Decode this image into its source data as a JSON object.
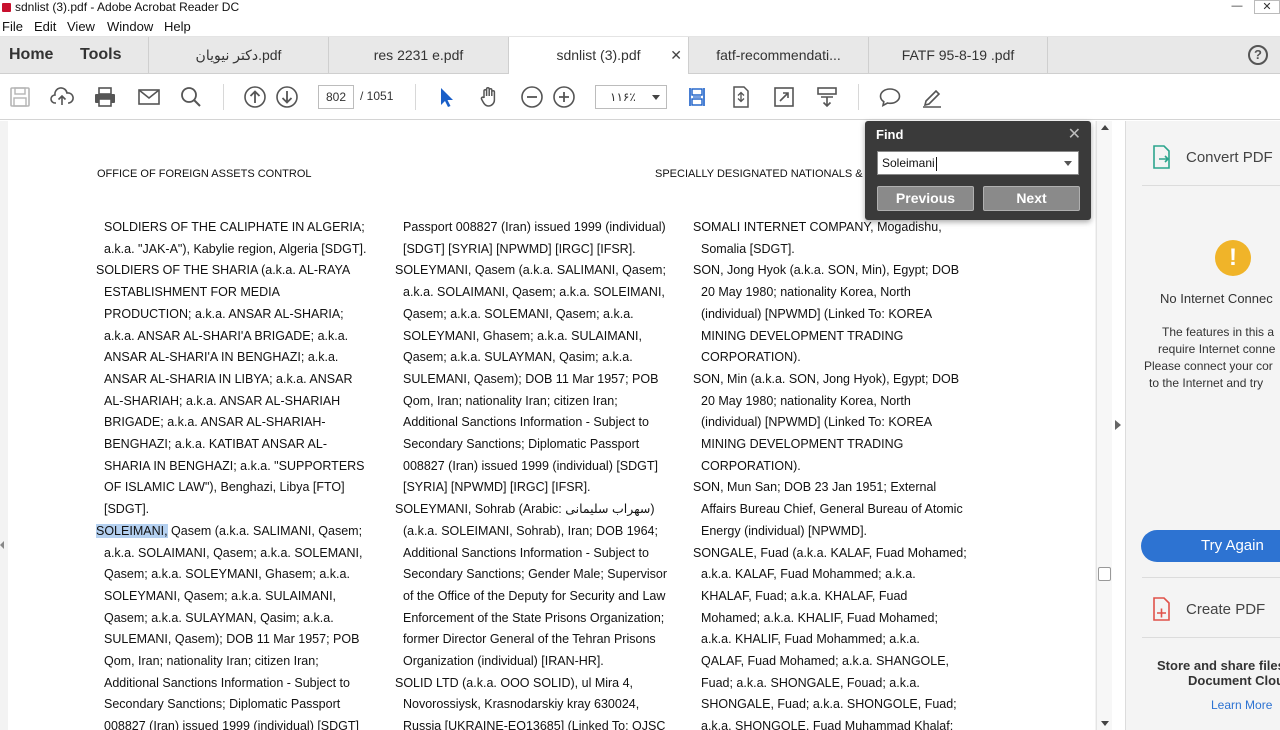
{
  "window": {
    "title": "sdnlist (3).pdf - Adobe Acrobat Reader DC",
    "min_label": "—",
    "close_label": "✕"
  },
  "menu": [
    "File",
    "Edit",
    "View",
    "Window",
    "Help"
  ],
  "nav_tabs": [
    "Home",
    "Tools"
  ],
  "doc_tabs": [
    {
      "label": "دکتر نیویان.pdf"
    },
    {
      "label": "res 2231 e.pdf"
    },
    {
      "label": "sdnlist (3).pdf",
      "active": true
    },
    {
      "label": "fatf-recommendati..."
    },
    {
      "label": "FATF  95-8-19  .pdf"
    }
  ],
  "tab_close": "✕",
  "help_label": "?",
  "toolbar": {
    "page_current": "802",
    "page_total": "/  1051",
    "zoom": "۱۱۶٪"
  },
  "find": {
    "title": "Find",
    "close": "✕",
    "query": "Soleimani",
    "previous": "Previous",
    "next": "Next"
  },
  "page": {
    "header_left": "OFFICE OF FOREIGN ASSETS CONTROL",
    "header_right": "SPECIALLY DESIGNATED NATIONALS & B",
    "col1": [
      {
        "t": "SOLDIERS OF THE CALIPHATE IN ALGERIA;",
        "i": true
      },
      {
        "t": "a.k.a. \"JAK-A\"), Kabylie region, Algeria [SDGT].",
        "i": true
      },
      {
        "t": "SOLDIERS OF THE SHARIA (a.k.a. AL-RAYA",
        "i": false
      },
      {
        "t": "ESTABLISHMENT FOR MEDIA",
        "i": true
      },
      {
        "t": "PRODUCTION; a.k.a. ANSAR AL-SHARIA;",
        "i": true
      },
      {
        "t": "a.k.a. ANSAR AL-SHARI'A BRIGADE; a.k.a.",
        "i": true
      },
      {
        "t": "ANSAR AL-SHARI'A IN BENGHAZI; a.k.a.",
        "i": true
      },
      {
        "t": "ANSAR AL-SHARIA IN LIBYA; a.k.a. ANSAR",
        "i": true
      },
      {
        "t": "AL-SHARIAH; a.k.a. ANSAR AL-SHARIAH",
        "i": true
      },
      {
        "t": "BRIGADE; a.k.a. ANSAR AL-SHARIAH-",
        "i": true
      },
      {
        "t": "BENGHAZI; a.k.a. KATIBAT ANSAR AL-",
        "i": true
      },
      {
        "t": "SHARIA IN BENGHAZI; a.k.a. \"SUPPORTERS",
        "i": true
      },
      {
        "t": "OF ISLAMIC LAW\"), Benghazi, Libya [FTO]",
        "i": true
      },
      {
        "t": "[SDGT].",
        "i": true
      },
      {
        "t": "Qasem (a.k.a. SALIMANI, Qasem;",
        "i": false,
        "hl": "SOLEIMANI,"
      },
      {
        "t": "a.k.a. SOLAIMANI, Qasem; a.k.a. SOLEMANI,",
        "i": true
      },
      {
        "t": "Qasem; a.k.a. SOLEYMANI, Ghasem; a.k.a.",
        "i": true
      },
      {
        "t": "SOLEYMANI, Qasem; a.k.a. SULAIMANI,",
        "i": true
      },
      {
        "t": "Qasem; a.k.a. SULAYMAN, Qasim; a.k.a.",
        "i": true
      },
      {
        "t": "SULEMANI, Qasem); DOB 11 Mar 1957; POB",
        "i": true
      },
      {
        "t": "Qom, Iran; nationality Iran; citizen Iran;",
        "i": true
      },
      {
        "t": "Additional Sanctions Information - Subject to",
        "i": true
      },
      {
        "t": "Secondary Sanctions; Diplomatic Passport",
        "i": true
      },
      {
        "t": "008827 (Iran) issued 1999 (individual) [SDGT]",
        "i": true
      }
    ],
    "col2": [
      {
        "t": "Passport 008827 (Iran) issued 1999 (individual)",
        "i": true
      },
      {
        "t": "[SDGT] [SYRIA] [NPWMD] [IRGC] [IFSR].",
        "i": true
      },
      {
        "t": "SOLEYMANI, Qasem (a.k.a. SALIMANI, Qasem;",
        "i": false
      },
      {
        "t": "a.k.a. SOLAIMANI, Qasem; a.k.a. SOLEIMANI,",
        "i": true
      },
      {
        "t": "Qasem; a.k.a. SOLEMANI, Qasem; a.k.a.",
        "i": true
      },
      {
        "t": "SOLEYMANI, Ghasem; a.k.a. SULAIMANI,",
        "i": true
      },
      {
        "t": "Qasem; a.k.a. SULAYMAN, Qasim; a.k.a.",
        "i": true
      },
      {
        "t": "SULEMANI, Qasem); DOB 11 Mar 1957; POB",
        "i": true
      },
      {
        "t": "Qom, Iran; nationality Iran; citizen Iran;",
        "i": true
      },
      {
        "t": "Additional Sanctions Information - Subject to",
        "i": true
      },
      {
        "t": "Secondary Sanctions; Diplomatic Passport",
        "i": true
      },
      {
        "t": "008827 (Iran) issued 1999 (individual) [SDGT]",
        "i": true
      },
      {
        "t": "[SYRIA] [NPWMD] [IRGC] [IFSR].",
        "i": true
      },
      {
        "t": "SOLEYMANI, Sohrab (Arabic: سهراب سلیمانی)",
        "i": false
      },
      {
        "t": "(a.k.a. SOLEIMANI, Sohrab), Iran; DOB 1964;",
        "i": true
      },
      {
        "t": "Additional Sanctions Information - Subject to",
        "i": true
      },
      {
        "t": "Secondary Sanctions; Gender Male; Supervisor",
        "i": true
      },
      {
        "t": "of the Office of the Deputy for Security and Law",
        "i": true
      },
      {
        "t": "Enforcement of the State Prisons Organization;",
        "i": true
      },
      {
        "t": "former Director General of the Tehran Prisons",
        "i": true
      },
      {
        "t": "Organization (individual) [IRAN-HR].",
        "i": true
      },
      {
        "t": "SOLID LTD (a.k.a. OOO SOLID), ul Mira 4,",
        "i": false
      },
      {
        "t": "Novorossiysk, Krasnodarskiy kray 630024,",
        "i": true
      },
      {
        "t": "Russia [UKRAINE-EO13685] (Linked To: OJSC",
        "i": true
      }
    ],
    "col3": [
      {
        "t": "SOMALI INTERNET COMPANY, Mogadishu,",
        "i": false
      },
      {
        "t": "Somalia [SDGT].",
        "i": true
      },
      {
        "t": "SON, Jong Hyok (a.k.a. SON, Min), Egypt; DOB",
        "i": false
      },
      {
        "t": "20 May 1980; nationality Korea, North",
        "i": true
      },
      {
        "t": "(individual) [NPWMD] (Linked To: KOREA",
        "i": true
      },
      {
        "t": "MINING DEVELOPMENT TRADING",
        "i": true
      },
      {
        "t": "CORPORATION).",
        "i": true
      },
      {
        "t": "SON, Min (a.k.a. SON, Jong Hyok), Egypt; DOB",
        "i": false
      },
      {
        "t": "20 May 1980; nationality Korea, North",
        "i": true
      },
      {
        "t": "(individual) [NPWMD] (Linked To: KOREA",
        "i": true
      },
      {
        "t": "MINING DEVELOPMENT TRADING",
        "i": true
      },
      {
        "t": "CORPORATION).",
        "i": true
      },
      {
        "t": "SON, Mun San; DOB 23 Jan 1951; External",
        "i": false
      },
      {
        "t": "Affairs Bureau Chief, General Bureau of Atomic",
        "i": true
      },
      {
        "t": "Energy (individual) [NPWMD].",
        "i": true
      },
      {
        "t": "SONGALE, Fuad (a.k.a. KALAF, Fuad Mohamed;",
        "i": false
      },
      {
        "t": "a.k.a. KALAF, Fuad Mohammed; a.k.a.",
        "i": true
      },
      {
        "t": "KHALAF, Fuad; a.k.a. KHALAF, Fuad",
        "i": true
      },
      {
        "t": "Mohamed; a.k.a. KHALIF, Fuad Mohamed;",
        "i": true
      },
      {
        "t": "a.k.a. KHALIF, Fuad Mohammed; a.k.a.",
        "i": true
      },
      {
        "t": "QALAF, Fuad Mohamed; a.k.a. SHANGOLE,",
        "i": true
      },
      {
        "t": "Fuad; a.k.a. SHONGALE, Fouad; a.k.a.",
        "i": true
      },
      {
        "t": "SHONGALE, Fuad; a.k.a. SHONGOLE, Fuad;",
        "i": true
      },
      {
        "t": "a.k.a. SHONGOLE, Fuad Muhammad Khalaf;",
        "i": true
      }
    ]
  },
  "right_panel": {
    "convert_pdf": "Convert PDF",
    "warning_symbol": "!",
    "no_internet": "No Internet Connec",
    "msg_lines": [
      "The features in this a",
      "require Internet conne",
      "Please connect your cor",
      "to the Internet and try"
    ],
    "try_again": "Try Again",
    "create_pdf": "Create PDF",
    "store_lines": [
      "Store and share files",
      "Document Clou"
    ],
    "learn_more": "Learn More"
  },
  "colors": {
    "accent": "#2d73d2",
    "highlight": "#b4d0f0",
    "find_bg": "#3a3a3a",
    "warning": "#f0b429",
    "red": "#c8102e"
  }
}
